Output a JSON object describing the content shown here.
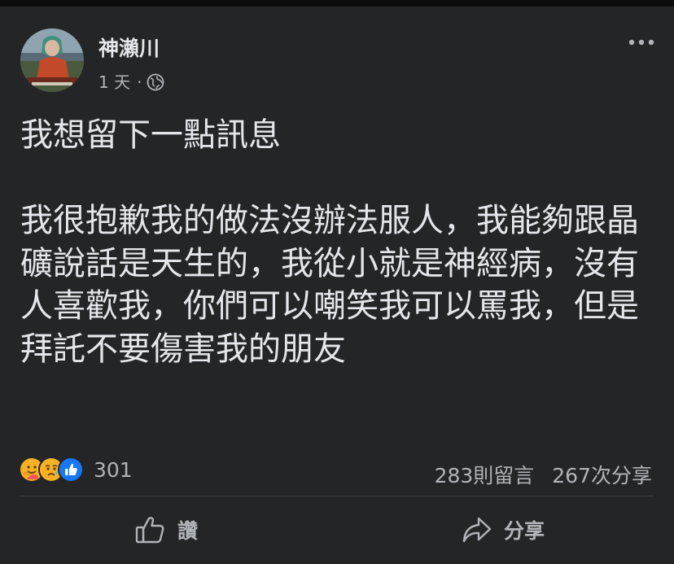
{
  "post": {
    "author": "神瀨川",
    "time": "1 天",
    "separator": "·",
    "privacy_icon": "globe-icon",
    "more_icon": "more-options-icon",
    "text": "我想留下一點訊息\n\n我很抱歉我的做法沒辦法服人，我能夠跟晶礦說話是天生的，我從小就是神經病，沒有人喜歡我，你們可以嘲笑我可以罵我，但是拜託不要傷害我的朋友"
  },
  "reactions": {
    "icons": [
      "care-reaction-icon",
      "sad-reaction-icon",
      "like-reaction-icon"
    ],
    "count": "301"
  },
  "stats": {
    "comments": "283則留言",
    "shares": "267次分享"
  },
  "actions": {
    "like_label": "讚",
    "share_label": "分享"
  },
  "colors": {
    "background": "#242526",
    "text": "#e4e6eb",
    "secondary_text": "#b0b3b8",
    "like_blue": "#1877f2",
    "reaction_yellow": "#f7b125"
  }
}
